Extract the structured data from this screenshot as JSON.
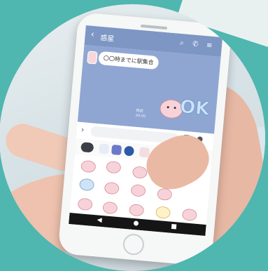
{
  "header": {
    "title": "惑星"
  },
  "chat": {
    "message": "〇〇時までに駅集合",
    "read_label": "既読",
    "timestamp": "00:00",
    "sticker_text": "OK"
  },
  "input": {
    "placeholder": ""
  },
  "icons": {
    "back": "chevron-left-icon",
    "search": "search-icon",
    "call": "phone-icon",
    "menu": "menu-icon",
    "expand": "chevron-right-icon",
    "emoji": "emoji-icon",
    "mic": "mic-icon"
  },
  "colors": {
    "header": "#7d96c4",
    "chat_bg": "#8fa6d2",
    "page_bg": "#4fb6b0"
  }
}
